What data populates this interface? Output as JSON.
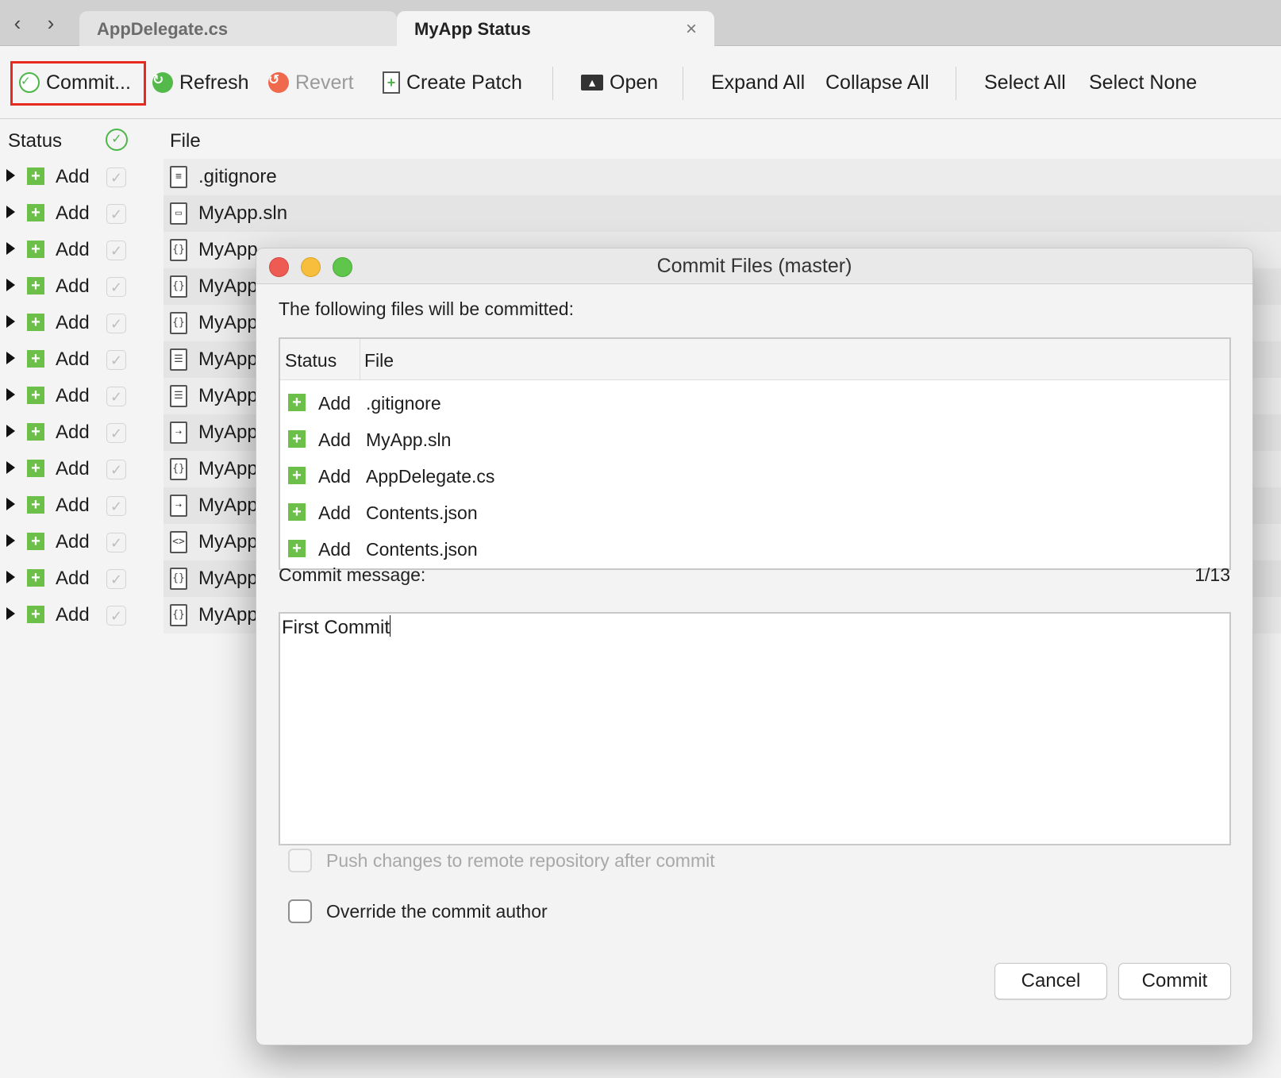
{
  "tabs": {
    "inactive_label": "AppDelegate.cs",
    "active_label": "MyApp Status",
    "close_glyph": "×",
    "back_glyph": "‹",
    "forward_glyph": "›"
  },
  "toolbar": {
    "commit": "Commit...",
    "refresh": "Refresh",
    "revert": "Revert",
    "create_patch": "Create Patch",
    "open": "Open",
    "expand_all": "Expand All",
    "collapse_all": "Collapse All",
    "select_all": "Select All",
    "select_none": "Select None",
    "highlight_color": "#e8291f"
  },
  "list": {
    "headers": {
      "status": "Status",
      "file": "File"
    },
    "rows": [
      {
        "status": "Add",
        "file": ".gitignore",
        "icon": "text-file-icon"
      },
      {
        "status": "Add",
        "file": "MyApp.sln",
        "icon": "solution-file-icon"
      },
      {
        "status": "Add",
        "file": "MyApp",
        "icon": "json-file-icon"
      },
      {
        "status": "Add",
        "file": "MyApp",
        "icon": "json-file-icon"
      },
      {
        "status": "Add",
        "file": "MyApp",
        "icon": "json-file-icon"
      },
      {
        "status": "Add",
        "file": "MyApp",
        "icon": "list-file-icon"
      },
      {
        "status": "Add",
        "file": "MyApp",
        "icon": "list-file-icon"
      },
      {
        "status": "Add",
        "file": "MyApp",
        "icon": "storyboard-file-icon"
      },
      {
        "status": "Add",
        "file": "MyApp",
        "icon": "json-file-icon"
      },
      {
        "status": "Add",
        "file": "MyApp",
        "icon": "storyboard-file-icon"
      },
      {
        "status": "Add",
        "file": "MyApp",
        "icon": "code-file-icon"
      },
      {
        "status": "Add",
        "file": "MyApp",
        "icon": "json-file-icon"
      },
      {
        "status": "Add",
        "file": "MyApp",
        "icon": "json-file-icon"
      }
    ]
  },
  "dialog": {
    "title": "Commit Files (master)",
    "intro": "The following files will be committed:",
    "table_headers": {
      "status": "Status",
      "file": "File"
    },
    "files": [
      {
        "status": "Add",
        "file": ".gitignore"
      },
      {
        "status": "Add",
        "file": "MyApp.sln"
      },
      {
        "status": "Add",
        "file": "AppDelegate.cs"
      },
      {
        "status": "Add",
        "file": "Contents.json"
      },
      {
        "status": "Add",
        "file": "Contents.json"
      }
    ],
    "message_label": "Commit message:",
    "message_counter": "1/13",
    "message_value": "First Commit",
    "push_option": "Push changes to remote repository after commit",
    "override_option": "Override the commit author",
    "cancel": "Cancel",
    "commit": "Commit"
  }
}
